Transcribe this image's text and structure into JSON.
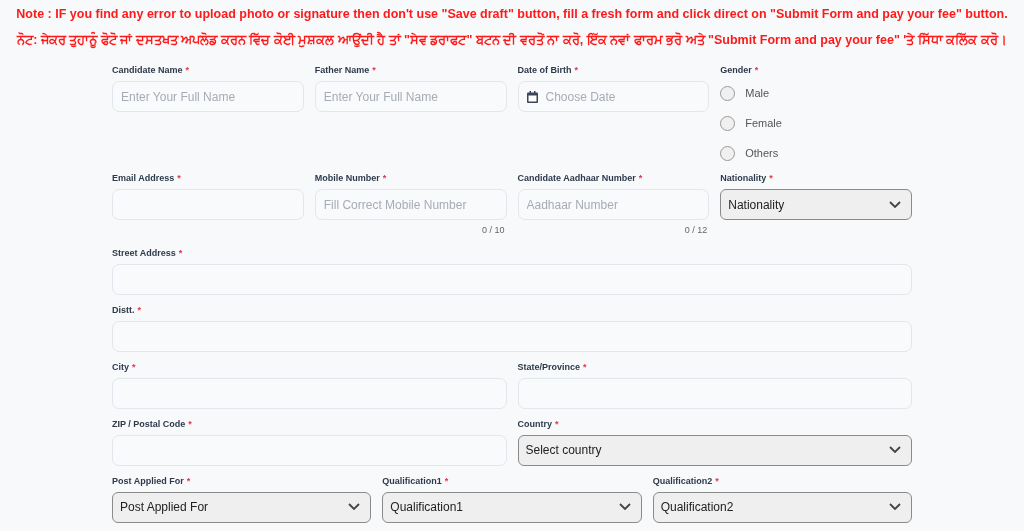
{
  "notes": [
    "Note : IF you find any error to upload photo or signature then don't use \"Save draft\" button, fill a fresh form and click direct on \"Submit Form and pay your fee\" button.",
    "ਨੋਟ: ਜੇਕਰ ਤੁਹਾਨੂੰ ਫੋਟੋ ਜਾਂ ਦਸਤਖਤ ਅਪਲੋਡ ਕਰਨ ਵਿੱਚ ਕੋਈ ਮੁਸ਼ਕਲ ਆਉਂਦੀ ਹੈ ਤਾਂ \"ਸੇਵ ਡਰਾਫਟ\" ਬਟਨ ਦੀ ਵਰਤੋਂ ਨਾ ਕਰੋ, ਇੱਕ ਨਵਾਂ ਫਾਰਮ ਭਰੋ ਅਤੇ \"Submit Form and pay your fee\" 'ਤੇ ਸਿੱਧਾ ਕਲਿੱਕ ਕਰੋ।"
  ],
  "rows": [
    [
      {
        "kind": "text",
        "label": "Candidate Name",
        "mark": "*",
        "placeholder": "Enter Your Full Name"
      },
      {
        "kind": "text",
        "label": "Father Name",
        "mark": "*",
        "placeholder": "Enter Your Full Name"
      },
      {
        "kind": "date",
        "label": "Date of Birth",
        "mark": "*",
        "placeholder": "Choose Date"
      },
      {
        "kind": "radio",
        "label": "Gender",
        "mark": "*",
        "options": [
          {
            "label": "Male",
            "selected": false
          },
          {
            "label": "Female",
            "selected": false
          },
          {
            "label": "Others",
            "selected": false
          }
        ]
      }
    ],
    [
      {
        "kind": "text",
        "label": "Email Address",
        "mark": "*"
      },
      {
        "kind": "text",
        "label": "Mobile Number",
        "mark": "*",
        "placeholder": "Fill Correct Mobile Number",
        "counter": "0 / 10"
      },
      {
        "kind": "text",
        "label": "Candidate Aadhaar Number",
        "mark": "*",
        "placeholder": "Aadhaar Number",
        "counter": "0 / 12"
      },
      {
        "kind": "select",
        "label": "Nationality",
        "mark": "*",
        "value": "Nationality"
      }
    ],
    [
      {
        "kind": "text",
        "label": "Street Address",
        "mark": "*"
      }
    ],
    [
      {
        "kind": "text",
        "label": "Distt.",
        "mark": "*"
      }
    ],
    [
      {
        "kind": "text",
        "label": "City",
        "mark": "*"
      },
      {
        "kind": "text",
        "label": "State/Province",
        "mark": "*"
      }
    ],
    [
      {
        "kind": "text",
        "label": "ZIP / Postal Code",
        "mark": "*"
      },
      {
        "kind": "select",
        "label": "Country",
        "mark": "*",
        "value": "Select country"
      }
    ],
    [
      {
        "kind": "select",
        "label": "Post Applied For",
        "mark": "*",
        "value": "Post Applied For"
      },
      {
        "kind": "select",
        "label": "Qualification1",
        "mark": "*",
        "value": "Qualification1"
      },
      {
        "kind": "select",
        "label": "Qualification2",
        "mark": "*",
        "value": "Qualification2"
      }
    ]
  ]
}
